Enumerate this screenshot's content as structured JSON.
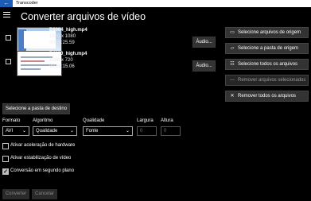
{
  "window": {
    "app_title": "Transcoder"
  },
  "page": {
    "title": "Converter arquivos de vídeo"
  },
  "files": [
    {
      "name": "B8004_high.mp4",
      "resolution": "1920 x 1080",
      "duration": "00:59:25.59",
      "audio_button": "Áudio..."
    },
    {
      "name": "P4100_high.mp4",
      "resolution": "1280 x 720",
      "duration": "00:26:15.06",
      "audio_button": "Áudio..."
    }
  ],
  "actions": {
    "select_source": "Selecione arquivos de origem",
    "select_source_folder": "Selecione a pasta de origem",
    "select_all": "Selecione todos os arquivos",
    "remove_selected": "Remover arquivos selecionados",
    "remove_all": "Remover todos os arquivos"
  },
  "destination_button": "Selecione a pasta de destino",
  "options": {
    "format_label": "Formato",
    "format_value": "AVI",
    "algorithm_label": "Algoritmo",
    "algorithm_value": "Qualidade",
    "quality_label": "Qualidade",
    "quality_value": "Fonte",
    "width_label": "Largura",
    "width_value": "0",
    "height_label": "Altura",
    "height_value": "0"
  },
  "checkboxes": [
    {
      "label": "Ativar aceleração de hardware",
      "checked": false
    },
    {
      "label": "Ativar estabilização de vídeo",
      "checked": false
    },
    {
      "label": "Conversão em segundo plano",
      "checked": true
    }
  ],
  "footer": {
    "convert": "Converter",
    "cancel": "Cancelar"
  }
}
